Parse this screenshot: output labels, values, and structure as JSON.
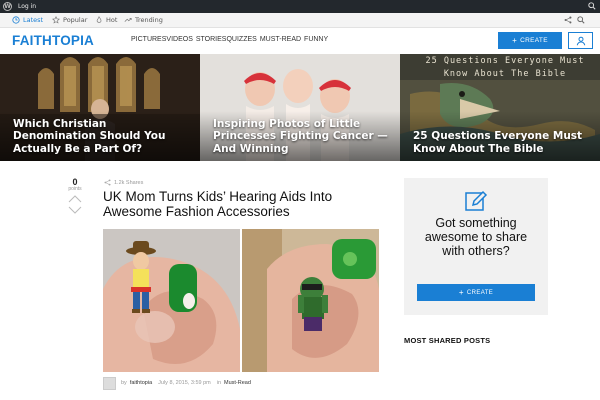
{
  "admin_bar": {
    "wp_logo": "W",
    "login_label": "Log in",
    "search_icon": "search-icon"
  },
  "sub_nav": {
    "items": [
      {
        "label": "Latest",
        "icon": "clock-icon",
        "active": true
      },
      {
        "label": "Popular",
        "icon": "star-icon",
        "active": false
      },
      {
        "label": "Hot",
        "icon": "flame-icon",
        "active": false
      },
      {
        "label": "Trending",
        "icon": "trending-icon",
        "active": false
      }
    ],
    "right_icons": [
      "share-icon",
      "search-icon"
    ]
  },
  "header": {
    "logo": "FAITHTOPIA",
    "menu": [
      "PICTURES",
      "VIDEOS",
      "STORIES",
      "QUIZZES",
      "MUST-READ",
      "FUNNY"
    ],
    "create_label": "CREATE",
    "user_icon": "user-icon",
    "accent_color": "#1a7fd4"
  },
  "hero": [
    {
      "title": "Which Christian Denomination Should You Actually Be a Part Of?"
    },
    {
      "title": "Inspiring Photos of Little Princesses Fighting Cancer — And Winning"
    },
    {
      "title": "25 Questions Everyone Must Know About The Bible",
      "overlay_text": "25 Questions Everyone Must Know About The Bible"
    }
  ],
  "article": {
    "points": "0",
    "points_label": "points",
    "shares": "1.2k Shares",
    "title": "UK Mom Turns Kids’ Hearing Aids Into Awesome Fashion Accessories",
    "author": "faithtopia",
    "date": "July 8, 2015, 3:59 pm",
    "in_label": "in",
    "category": "Must-Read",
    "by_label": "by"
  },
  "sidebar": {
    "widget_text": "Got something awesome to share with others?",
    "widget_button": "CREATE",
    "most_shared_title": "MOST SHARED POSTS"
  }
}
